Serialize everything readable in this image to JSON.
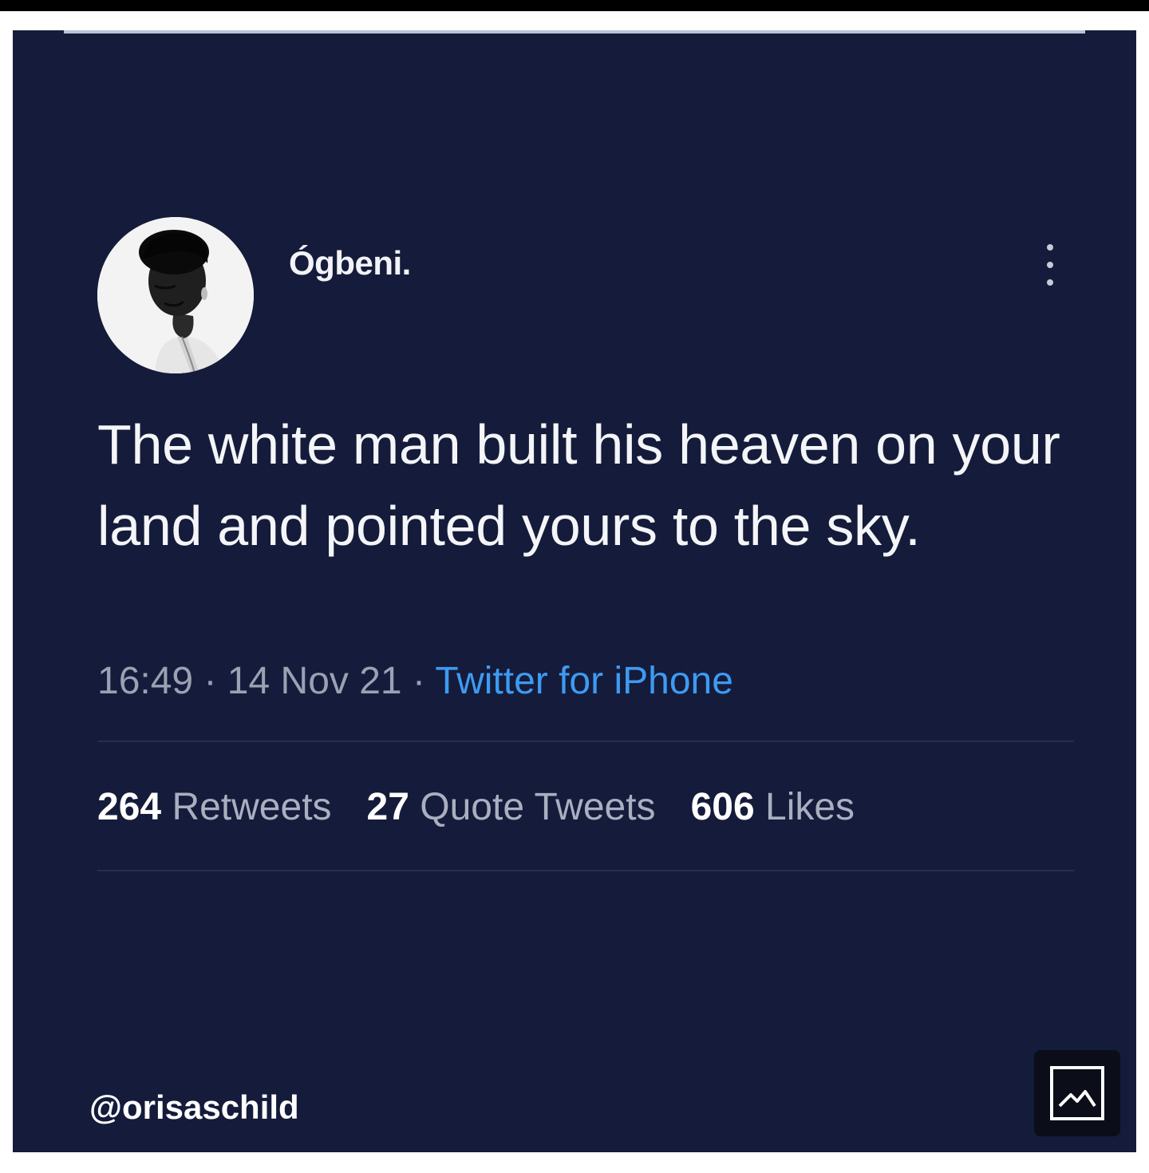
{
  "tweet": {
    "display_name": "Ógbeni.",
    "text": "The white man built his heaven on your land and pointed yours to the sky.",
    "time": "16:49",
    "date": "14 Nov 21",
    "source": "Twitter for iPhone",
    "stats": {
      "retweets_count": "264",
      "retweets_label": "Retweets",
      "quote_tweets_count": "27",
      "quote_tweets_label": "Quote Tweets",
      "likes_count": "606",
      "likes_label": "Likes"
    }
  },
  "footer": {
    "handle": "@orisaschild"
  },
  "icons": {
    "more": "more-vertical-icon",
    "image": "image-icon"
  },
  "colors": {
    "background": "#151b3a",
    "link": "#3d9bf2",
    "text": "#f4f5f8"
  }
}
